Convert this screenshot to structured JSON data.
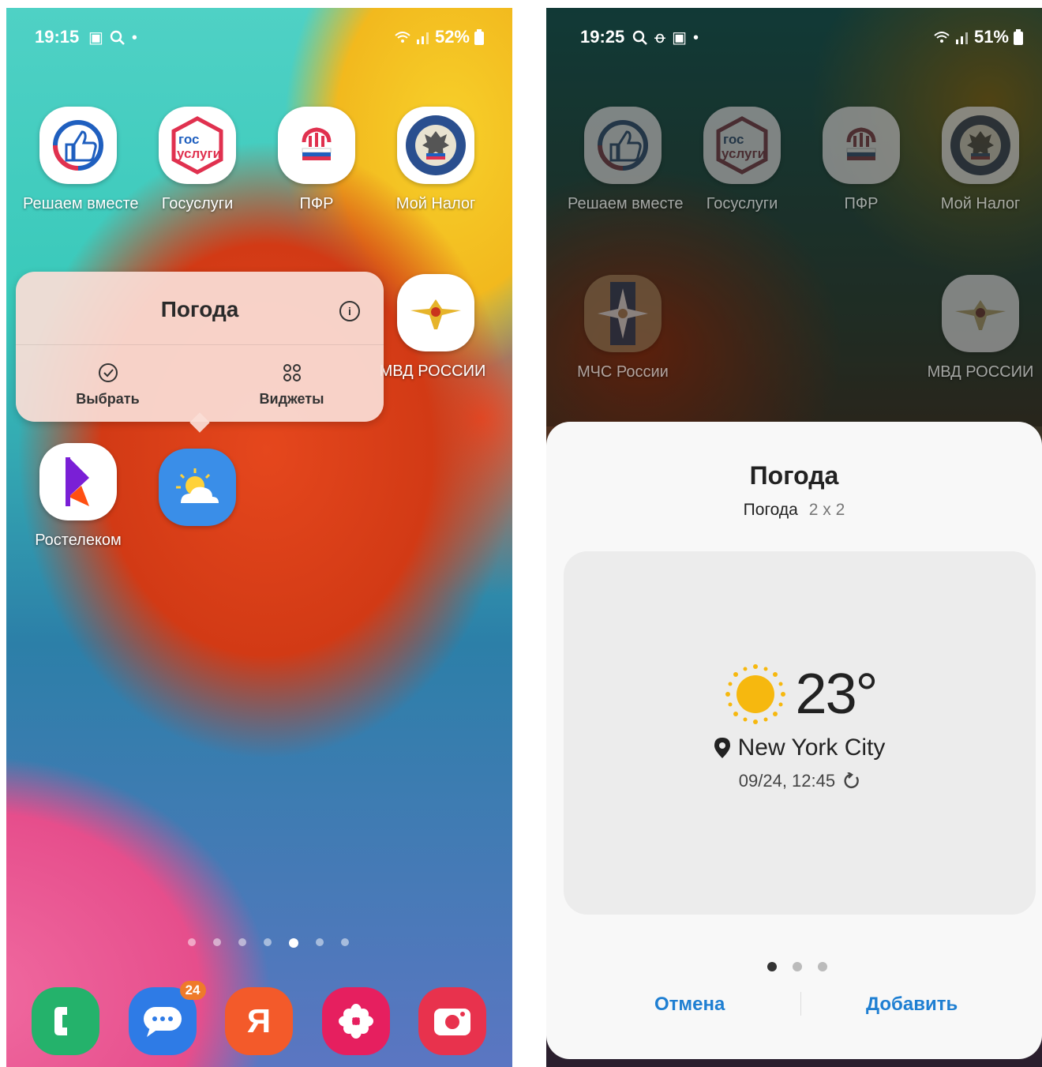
{
  "left_screen": {
    "status": {
      "time": "19:15",
      "battery": "52%"
    },
    "apps_row1": [
      {
        "label": "Решаем вместе",
        "icon": "thumbs-up-icon"
      },
      {
        "label": "Госуслуги",
        "icon": "gosuslugi-icon",
        "icon_text1": "гос",
        "icon_text2": "услуги"
      },
      {
        "label": "ПФР",
        "icon": "pfr-icon"
      },
      {
        "label": "Мой Налог",
        "icon": "tax-service-emblem-icon"
      }
    ],
    "mvd": {
      "label": "МВД РОССИИ"
    },
    "popup": {
      "title": "Погода",
      "select_label": "Выбрать",
      "widgets_label": "Виджеты"
    },
    "apps_row3": [
      {
        "label": "Ростелеком"
      },
      {
        "label": ""
      }
    ],
    "dock": {
      "messages_badge": "24",
      "yandex_letter": "Я"
    }
  },
  "right_screen": {
    "status": {
      "time": "19:25",
      "battery": "51%"
    },
    "apps_row1": [
      {
        "label": "Решаем вместе"
      },
      {
        "label": "Госуслуги",
        "icon_text1": "гос",
        "icon_text2": "услуги"
      },
      {
        "label": "ПФР"
      },
      {
        "label": "Мой Налог"
      }
    ],
    "apps_row2": [
      {
        "label": "МЧС России"
      },
      {
        "label": "МВД РОССИИ"
      }
    ],
    "sheet": {
      "title": "Погода",
      "subtitle": "Погода",
      "size": "2 x 2",
      "temperature": "23°",
      "city": "New York City",
      "datetime": "09/24, 12:45",
      "cancel_label": "Отмена",
      "add_label": "Добавить"
    }
  },
  "colors": {
    "accent_blue": "#1f7fd2",
    "gosuslugi_red": "#e0314f",
    "dock_green": "#24b26b",
    "dock_blue": "#2e7be6",
    "dock_orange": "#f35a2a",
    "dock_pink": "#e61f5f",
    "dock_red": "#e8324d"
  }
}
